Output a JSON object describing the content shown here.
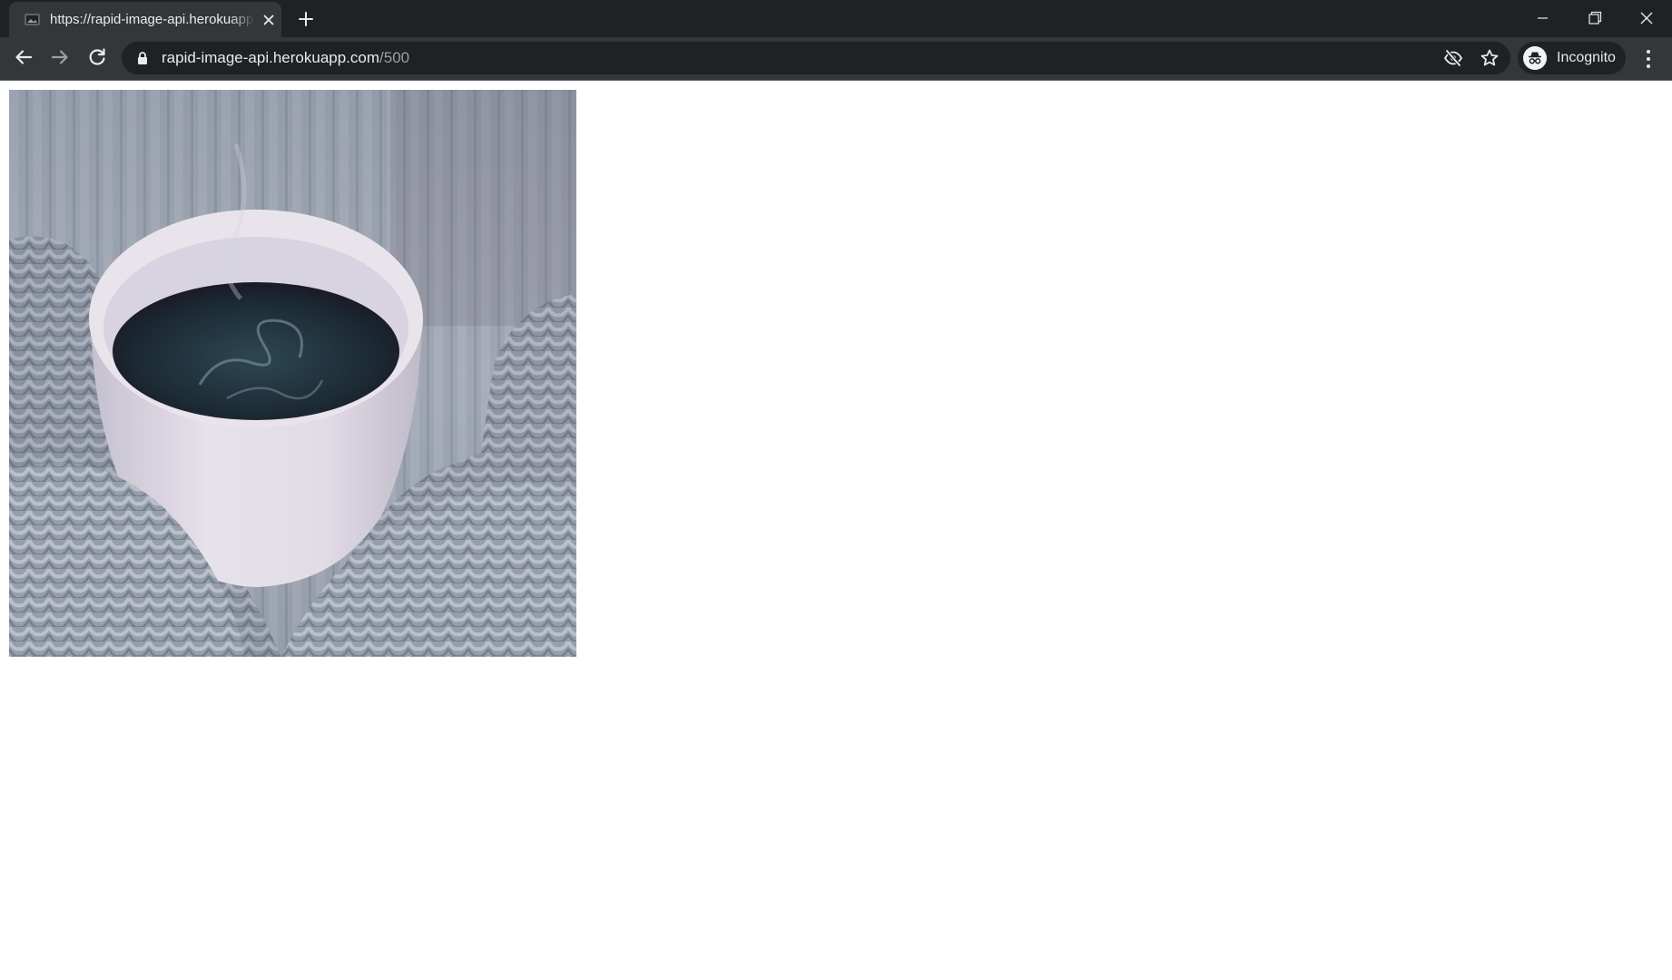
{
  "browser": {
    "tab": {
      "title": "https://rapid-image-api.herokuapp.com/500",
      "favicon": "image-favicon-icon"
    },
    "address_bar": {
      "host": "rapid-image-api.herokuapp.com",
      "path": "/500"
    },
    "profile": {
      "label": "Incognito",
      "icon": "incognito-icon"
    },
    "window_controls": [
      "minimize-icon",
      "restore-icon",
      "close-icon"
    ],
    "colors": {
      "tabstrip": "#202124",
      "toolbar": "#35363a",
      "omnibox": "#202124",
      "text": "#e8eaed",
      "muted_text": "#9aa0a6"
    }
  },
  "page": {
    "image": {
      "subject": "coffee-cup-in-knit-mittens-photo"
    }
  }
}
